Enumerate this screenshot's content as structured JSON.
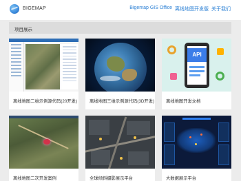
{
  "header": {
    "brand": "BIGEMAP",
    "nav": [
      {
        "label": "Bigemap GIS Office"
      },
      {
        "label": "离线地图开发版"
      },
      {
        "label": "关于我们"
      }
    ]
  },
  "section": {
    "title": "项目展示"
  },
  "projects": [
    {
      "label": "离线地图二维示例源代码(20开发)"
    },
    {
      "label": "离线地图三维示例源代码(3D开发)"
    },
    {
      "label": "离线地图开发文档"
    },
    {
      "label": "离线地图二次开发案例"
    },
    {
      "label": "全球倾斜摄影展示平台"
    },
    {
      "label": "大数据展示平台"
    }
  ],
  "thumbnail_icons": [
    "api-icon"
  ]
}
